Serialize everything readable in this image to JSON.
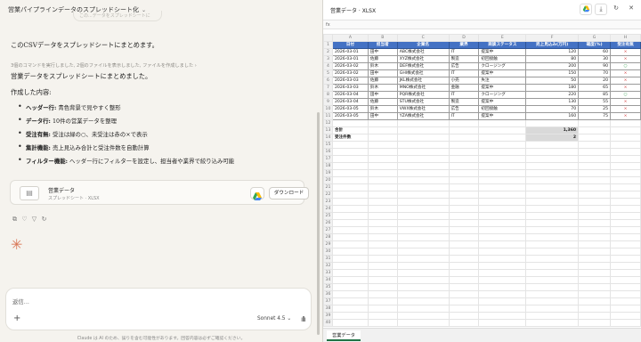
{
  "left": {
    "chat_title": "営業パイプラインデータのスプレッドシート化",
    "ghost_text": "この...データをスプレッドシートに",
    "user_msg": "このCSVデータをスプレッドシートにまとめます。",
    "tool_line": "3個のコマンドを実行しました, 2個のファイルを表示しました, ファイルを作成しました ›",
    "assistant_intro": "営業データをスプレッドシートにまとめました。",
    "contents_heading": "作成した内容:",
    "bullets": [
      {
        "bold": "ヘッダー行:",
        "text": " 青色背景で見やすく整形"
      },
      {
        "bold": "データ行:",
        "text": " 10件の営業データを整理"
      },
      {
        "bold": "受注有無:",
        "text": " 受注は緑の○、未受注は赤の×で表示"
      },
      {
        "bold": "集計機能:",
        "text": " 売上見込み合計と受注件数を自動計算"
      },
      {
        "bold": "フィルター機能:",
        "text": " ヘッダー行にフィルターを設定し、担当者や業界で絞り込み可能"
      }
    ],
    "file_card": {
      "name": "営業データ",
      "meta": "スプレッドシート · XLSX",
      "download_label": "ダウンロード"
    },
    "input_placeholder": "返信...",
    "model_label": "Sonnet 4.5",
    "disclaimer": "Claude は AI のため、誤りを含む可能性があります。回答内容は必ずご確認ください。"
  },
  "right": {
    "doc_title": "営業データ · XLSX",
    "fx_label": "fx",
    "column_letters": [
      "",
      "A",
      "B",
      "C",
      "D",
      "E",
      "F",
      "G",
      "H"
    ],
    "header_row": [
      "日付",
      "担当者",
      "企業名",
      "業界",
      "商談ステータス",
      "売上見込み(万円)",
      "確度(%)",
      "受注有無"
    ],
    "rows": [
      [
        "2026-03-01",
        "田中",
        "ABC株式会社",
        "IT",
        "提案中",
        "120",
        "60",
        "×"
      ],
      [
        "2026-03-01",
        "佐藤",
        "XYZ株式会社",
        "製造",
        "初回接触",
        "80",
        "30",
        "×"
      ],
      [
        "2026-03-02",
        "鈴木",
        "DEF株式会社",
        "広告",
        "クロージング",
        "200",
        "90",
        "○"
      ],
      [
        "2026-03-02",
        "田中",
        "GHI株式会社",
        "IT",
        "提案中",
        "150",
        "70",
        "×"
      ],
      [
        "2026-03-03",
        "佐藤",
        "JKL株式会社",
        "小売",
        "失注",
        "50",
        "20",
        "×"
      ],
      [
        "2026-03-03",
        "鈴木",
        "MNO株式会社",
        "金融",
        "提案中",
        "180",
        "65",
        "×"
      ],
      [
        "2026-03-04",
        "田中",
        "PQR株式会社",
        "IT",
        "クロージング",
        "220",
        "85",
        "○"
      ],
      [
        "2026-03-04",
        "佐藤",
        "STU株式会社",
        "製造",
        "提案中",
        "130",
        "55",
        "×"
      ],
      [
        "2026-03-05",
        "鈴木",
        "VWX株式会社",
        "広告",
        "初回接触",
        "70",
        "25",
        "×"
      ],
      [
        "2026-03-05",
        "田中",
        "YZA株式会社",
        "IT",
        "提案中",
        "160",
        "75",
        "×"
      ]
    ],
    "total_label": "合計",
    "total_value": "1,360",
    "won_label": "受注件数",
    "won_value": "2",
    "sheet_tab": "営業データ"
  }
}
